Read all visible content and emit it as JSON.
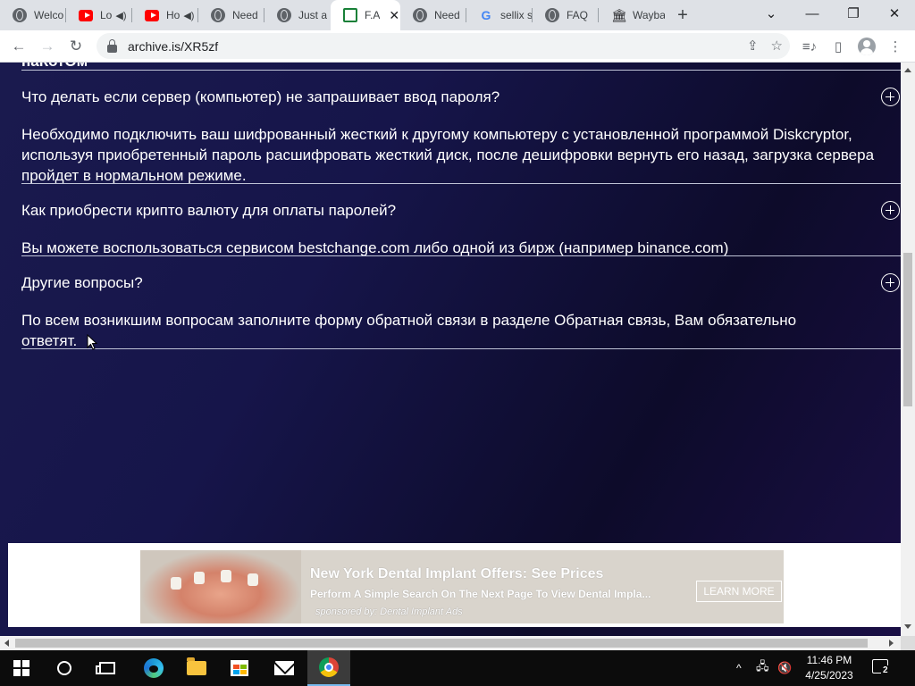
{
  "browser": {
    "tabs": [
      {
        "label": "Welco",
        "icon": "globe-icon",
        "sound": false,
        "active": false
      },
      {
        "label": "Lo",
        "icon": "youtube-icon",
        "sound": true,
        "active": false
      },
      {
        "label": "Ho",
        "icon": "youtube-icon",
        "sound": true,
        "active": false
      },
      {
        "label": "Need",
        "icon": "globe-icon",
        "sound": false,
        "active": false
      },
      {
        "label": "Just a",
        "icon": "globe-icon",
        "sound": false,
        "active": false
      },
      {
        "label": "F.A",
        "icon": "sheet-icon",
        "sound": false,
        "active": true
      },
      {
        "label": "Need",
        "icon": "globe-icon",
        "sound": false,
        "active": false
      },
      {
        "label": "sellix s",
        "icon": "google-icon",
        "sound": false,
        "active": false
      },
      {
        "label": "FAQ",
        "icon": "globe-icon",
        "sound": false,
        "active": false
      },
      {
        "label": "Wayba",
        "icon": "archive-icon",
        "sound": false,
        "active": false
      }
    ],
    "url": "archive.is/XR5zf"
  },
  "page": {
    "cut_text": "наКотОм",
    "faq": [
      {
        "question": "Что делать если сервер (компьютер) не запрашивает ввод пароля?",
        "answer": "Необходимо подключить ваш шифрованный жесткий к другому компьютеру с установленной программой Diskcryptor, используя приобретенный пароль расшифровать жесткий диск, после дешифровки вернуть его назад, загрузка сервера пройдет в нормальном режиме."
      },
      {
        "question": "Как приобрести крипто валюту для оплаты паролей?",
        "answer": "Вы можете воспользоваться сервисом bestchange.com либо одной из бирж (например binance.com)"
      },
      {
        "question": "Другие вопросы?",
        "answer": "По всем возникшим вопросам заполните форму обратной связи в разделе Обратная связь, Вам обязательно ответят."
      }
    ],
    "ad": {
      "title": "New York Dental Implant Offers: See Prices",
      "text": "Perform A Simple Search On The Next Page To View Dental Impla...",
      "sponsor": "sponsored by: Dental Implant Ads",
      "button": "LEARN MORE"
    }
  },
  "taskbar": {
    "time": "11:46 PM",
    "date": "4/25/2023",
    "notifications": "2"
  }
}
